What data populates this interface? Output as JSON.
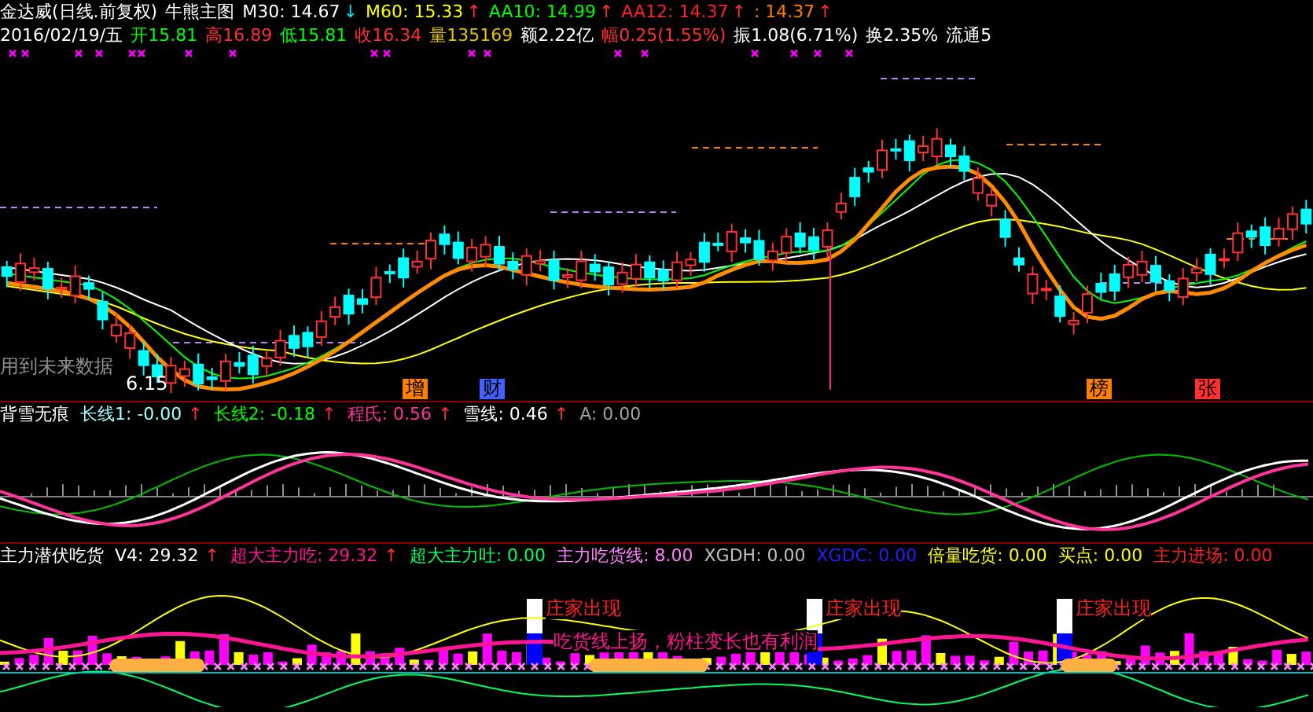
{
  "title": {
    "stock": "金达威(日线.前复权)",
    "template": "牛熊主图"
  },
  "averages": [
    {
      "text": "M30: 14.67",
      "color": "#ffffff",
      "arrow": "↓",
      "rising": false
    },
    {
      "text": "M60: 15.33",
      "color": "#ffff00",
      "arrow": "↑",
      "rising": true
    },
    {
      "text": "AA10: 14.99",
      "color": "#00ff00",
      "arrow": "↑",
      "rising": true
    },
    {
      "text": "AA12: 14.37",
      "color": "#ff2020",
      "arrow": "↑",
      "rising": true
    },
    {
      "text": ": 14.37",
      "color": "#ff8000",
      "arrow": "↑",
      "rising": true
    }
  ],
  "quote": [
    {
      "text": "2016/02/19/五",
      "color": "#ffffff"
    },
    {
      "text": "开15.81",
      "color": "#00ff00"
    },
    {
      "text": "高16.89",
      "color": "#ff3030"
    },
    {
      "text": "低15.81",
      "color": "#00ff00"
    },
    {
      "text": "收16.34",
      "color": "#ff3030"
    },
    {
      "text": "量135169",
      "color": "#e0c000"
    },
    {
      "text": "额2.22亿",
      "color": "#ffffff"
    },
    {
      "text": "幅0.25(1.55%)",
      "color": "#ff3030"
    },
    {
      "text": "振1.08(6.71%)",
      "color": "#ffffff"
    },
    {
      "text": "换2.35%",
      "color": "#ffffff"
    },
    {
      "text": "流通5",
      "color": "#ffffff"
    }
  ],
  "main_chart": {
    "notes": [
      {
        "text": "用到未来数据"
      },
      {
        "text": "6.15"
      }
    ],
    "markers": [
      {
        "text": "增",
        "color": "#ff8000"
      },
      {
        "text": "财",
        "color": "#4060ff"
      },
      {
        "text": "榜",
        "color": "#ff8000"
      },
      {
        "text": "张",
        "color": "#ff3030"
      }
    ]
  },
  "indicator_1": {
    "name": "背雪无痕",
    "values": [
      {
        "text": "长线1: -0.00",
        "color": "#a0ffff",
        "arrow": "↑",
        "rising": true
      },
      {
        "text": "长线2: -0.18",
        "color": "#00ff00",
        "arrow": "↑",
        "rising": true
      },
      {
        "text": "程氏: 0.56",
        "color": "#ff3399",
        "arrow": "↑",
        "rising": true
      },
      {
        "text": "雪线: 0.46",
        "color": "#ffffff",
        "arrow": "↑",
        "rising": true
      },
      {
        "text": "A: 0.00",
        "color": "#a0a0a0"
      }
    ]
  },
  "indicator_2": {
    "name": "主力潜伏吃货",
    "values": [
      {
        "text": "V4: 29.32",
        "color": "#ffffff",
        "arrow": "↑",
        "rising": true
      },
      {
        "text": "超大主力吃: 29.32",
        "color": "#ff1493",
        "arrow": "↑",
        "rising": true
      },
      {
        "text": "超大主力吐: 0.00",
        "color": "#00ff60"
      },
      {
        "text": "主力吃货线: 8.00",
        "color": "#ff80ff"
      },
      {
        "text": "XGDH: 0.00",
        "color": "#c0c0c0"
      },
      {
        "text": "XGDC: 0.00",
        "color": "#2020ff"
      },
      {
        "text": "倍量吃货: 0.00",
        "color": "#ffff00"
      },
      {
        "text": "买点: 0.00",
        "color": "#ffff00"
      },
      {
        "text": "主力进场: 0.00",
        "color": "#ff2020"
      }
    ],
    "signals": [
      {
        "text": "庄家出现"
      },
      {
        "text": "庄家出现"
      },
      {
        "text": "庄家出现"
      }
    ],
    "comment": "吃货线上扬，粉柱变长也有利润"
  }
}
